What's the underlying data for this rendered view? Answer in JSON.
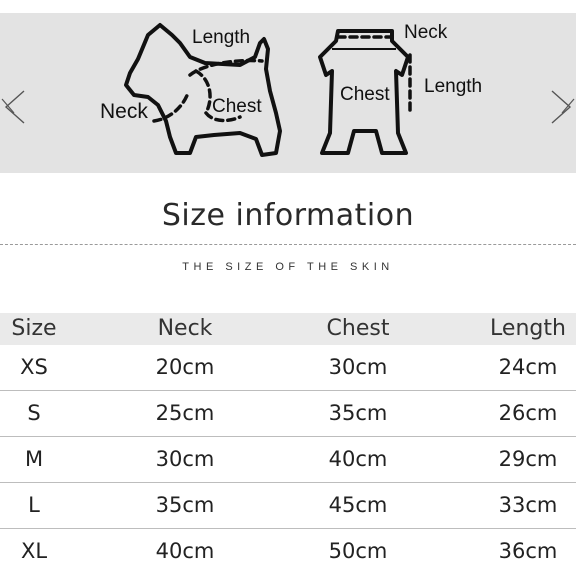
{
  "diagram": {
    "dog_labels": {
      "length": "Length",
      "neck": "Neck",
      "chest": "Chest"
    },
    "garment_labels": {
      "neck": "Neck",
      "chest": "Chest",
      "length": "Length"
    }
  },
  "heading": {
    "title": "Size information",
    "subtitle": "THE SIZE OF THE SKIN"
  },
  "table": {
    "headers": [
      "Size",
      "Neck",
      "Chest",
      "Length"
    ],
    "rows": [
      [
        "XS",
        "20cm",
        "30cm",
        "24cm"
      ],
      [
        "S",
        "25cm",
        "35cm",
        "26cm"
      ],
      [
        "M",
        "30cm",
        "40cm",
        "29cm"
      ],
      [
        "L",
        "35cm",
        "45cm",
        "33cm"
      ],
      [
        "XL",
        "40cm",
        "50cm",
        "36cm"
      ]
    ]
  },
  "colors": {
    "banner_bg": "#e3e3e3",
    "header_bg": "#eaeaea",
    "ink": "#222222"
  },
  "icons": [
    "prev-arrow-icon",
    "next-arrow-icon",
    "dog-silhouette-icon",
    "garment-icon"
  ]
}
